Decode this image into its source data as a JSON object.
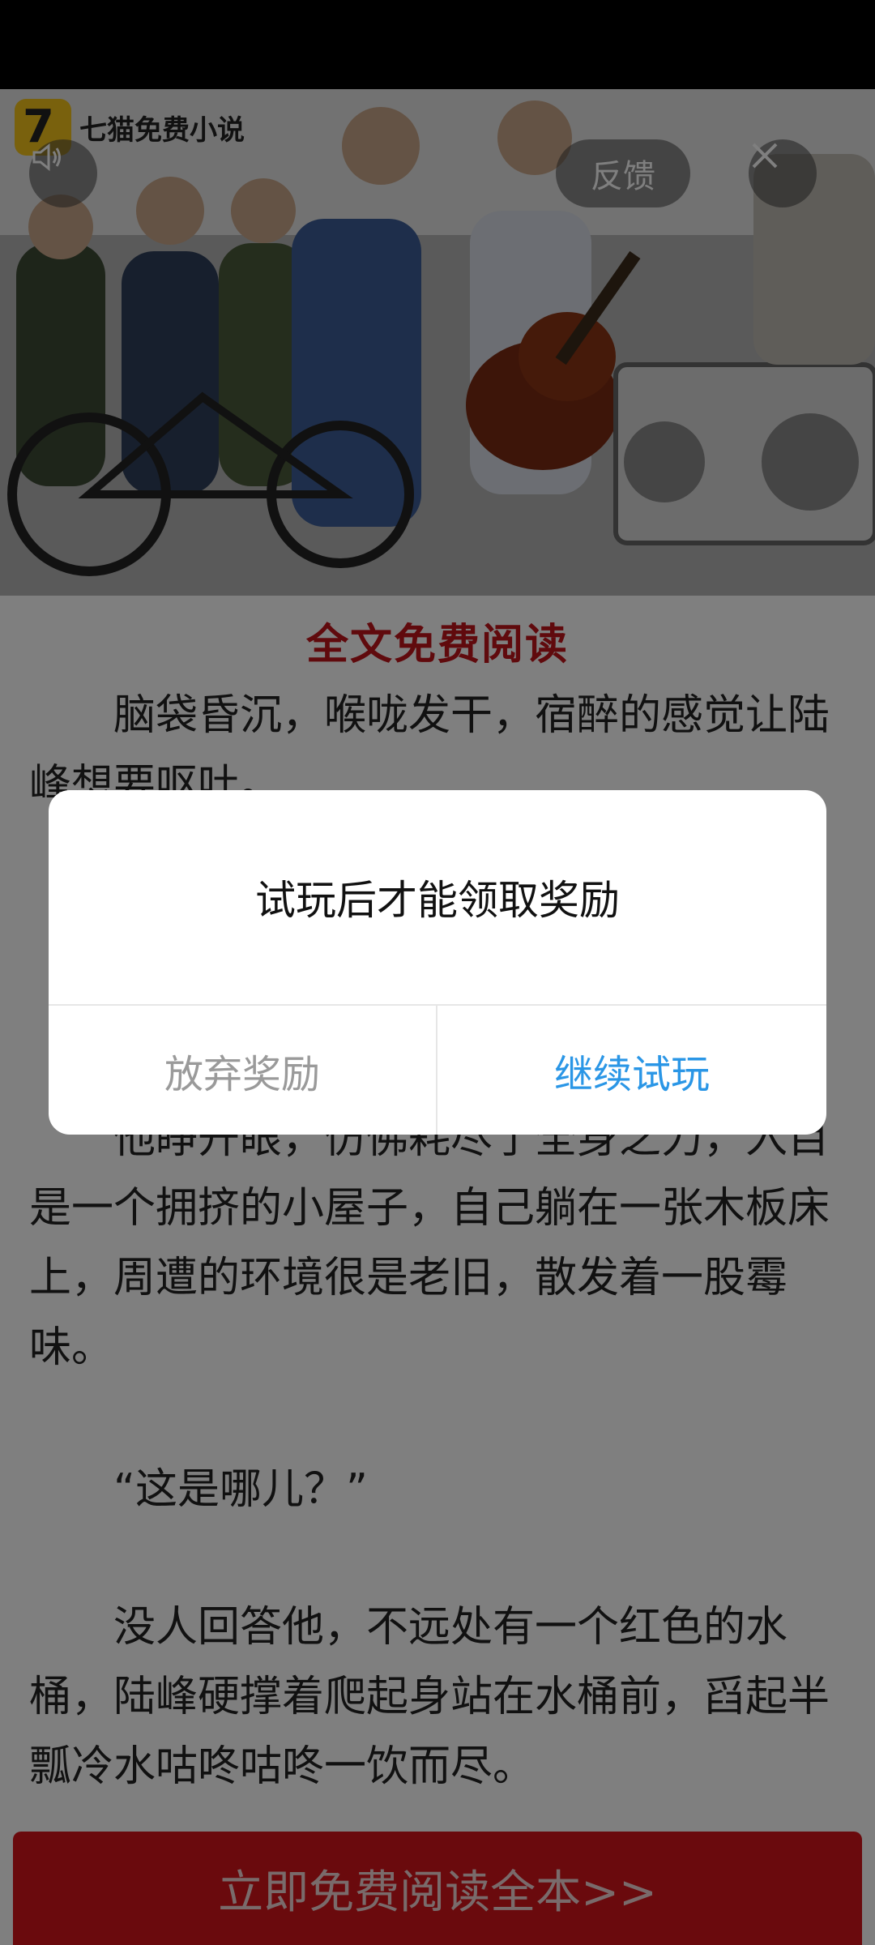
{
  "ad": {
    "brand": "七猫免费小说",
    "feedback_label": "反馈",
    "icons": [
      "volume-icon",
      "close-icon"
    ]
  },
  "article": {
    "title": "全文免费阅读",
    "paragraphs": [
      "脑袋昏沉，喉咙发干，宿醉的感觉让陆峰想要呕吐。",
      "他睁开眼，仿佛耗尽了全身之力，入目是一个拥挤的小屋子，自己躺在一张木板床上，周遭的环境很是老旧，散发着一股霉味。",
      "“这是哪儿？”",
      "没人回答他，不远处有一个红色的水桶，陆峰硬撑着爬起身站在水桶前，舀起半瓢冷水咕咚咕咚一饮而尽。"
    ],
    "cta_label": "立即免费阅读全本>>"
  },
  "dialog": {
    "message": "试玩后才能领取奖励",
    "give_up_label": "放弃奖励",
    "continue_label": "继续试玩"
  },
  "colors": {
    "accent_red": "#c0141b",
    "cta_red": "#d4141b",
    "continue_blue": "#2a96e6",
    "give_up_gray": "#9a9a9a"
  }
}
